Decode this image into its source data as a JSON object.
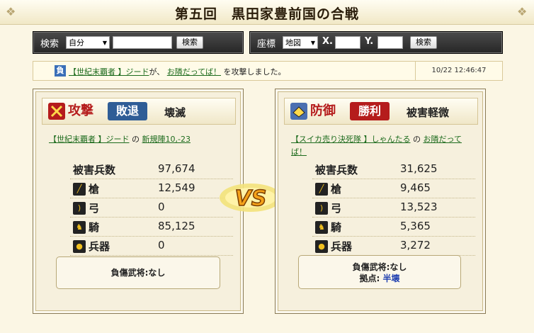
{
  "title": "第五回　黒田家豊前国の合戦",
  "search_left": {
    "label": "検索",
    "select": "自分",
    "button": "検索"
  },
  "search_right": {
    "label": "座標",
    "select": "地図",
    "x_label": "X.",
    "y_label": "Y.",
    "button": "検索"
  },
  "log": {
    "badge": "負",
    "alliance": "【世紀末覇者 】",
    "player": "ジード",
    "text1": "が、",
    "target": "お隣だってば！",
    "text2": "を攻撃しました。",
    "time": "10/22 12:46:47"
  },
  "attack": {
    "label": "攻撃",
    "result": "敗退",
    "damage": "壊滅",
    "alliance": "【世紀末覇者 】",
    "player": "ジード",
    "mid": "の",
    "location": "新規陣10,-23",
    "header_name": "被害兵数",
    "header_value": "97,674",
    "rows": [
      {
        "icon": "spear-icon",
        "name": "槍",
        "value": "12,549"
      },
      {
        "icon": "bow-icon",
        "name": "弓",
        "value": "0"
      },
      {
        "icon": "horse-icon",
        "name": "騎",
        "value": "85,125"
      },
      {
        "icon": "siege-icon",
        "name": "兵器",
        "value": "0"
      }
    ],
    "injured": "負傷武将:なし"
  },
  "defense": {
    "label": "防御",
    "result": "勝利",
    "damage": "被害軽微",
    "alliance": "【スイカ売り決死隊 】",
    "player": "しゃんたる",
    "mid": "の",
    "location": "お隣だってば！",
    "header_name": "被害兵数",
    "header_value": "31,625",
    "rows": [
      {
        "icon": "spear-icon",
        "name": "槍",
        "value": "9,465"
      },
      {
        "icon": "bow-icon",
        "name": "弓",
        "value": "13,523"
      },
      {
        "icon": "horse-icon",
        "name": "騎",
        "value": "5,365"
      },
      {
        "icon": "siege-icon",
        "name": "兵器",
        "value": "3,272"
      }
    ],
    "injured": "負傷武将:なし",
    "base_label": "拠点:",
    "base_value": "半壊"
  },
  "vs_text": "VS",
  "colors": {
    "attack_red": "#b51c1c",
    "lose_blue": "#2f5d96",
    "win_red": "#b51c1c",
    "link_green": "#1d6b1d"
  }
}
